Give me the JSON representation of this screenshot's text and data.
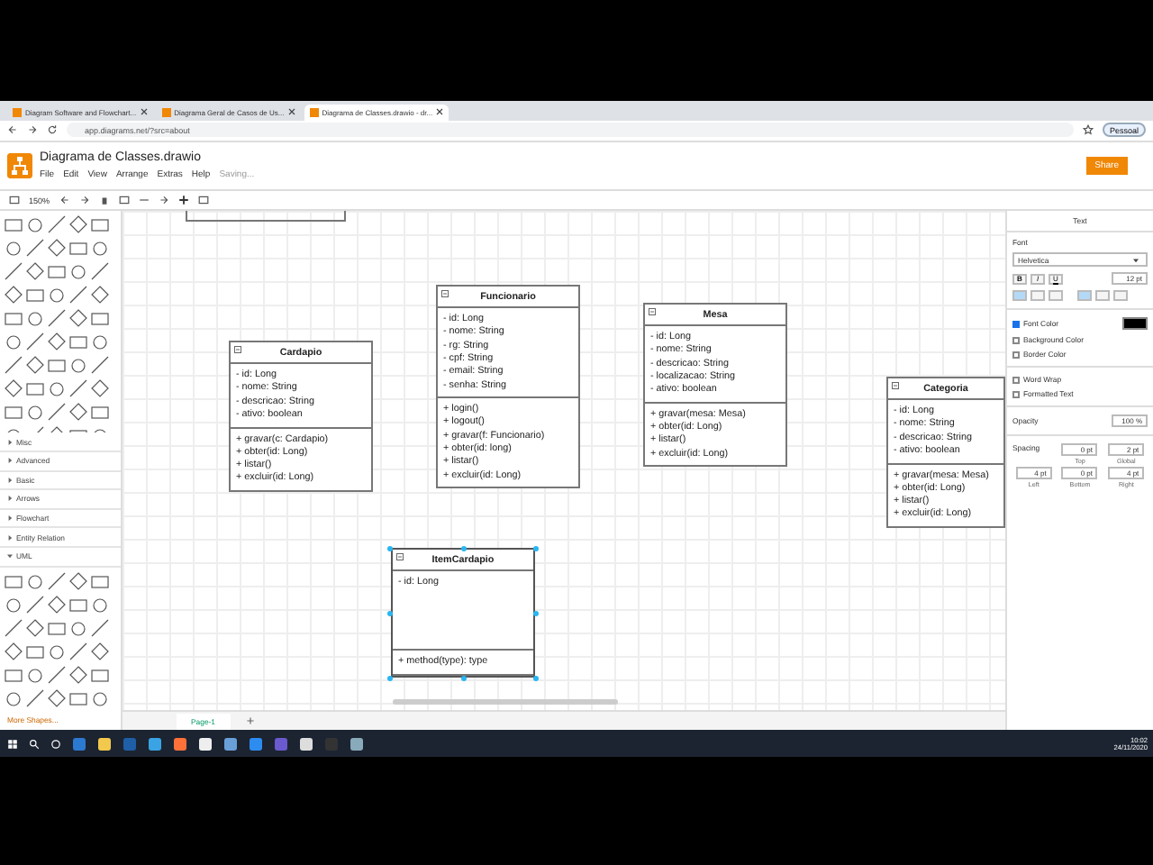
{
  "browser": {
    "tabs": [
      {
        "title": "Diagram Software and Flowchart...",
        "selected": false
      },
      {
        "title": "Diagrama Geral de Casos de Us...",
        "selected": false
      },
      {
        "title": "Diagrama de Classes.drawio - dr...",
        "selected": true
      }
    ],
    "address": "app.diagrams.net/?src=about",
    "profile": "Pessoal"
  },
  "app": {
    "title": "Diagrama de Classes.drawio",
    "menus": [
      "File",
      "Edit",
      "View",
      "Arrange",
      "Extras",
      "Help"
    ],
    "status": "Saving...",
    "share": "Share"
  },
  "toolbar": {
    "zoom": "150%"
  },
  "sidebar": {
    "sections": [
      {
        "label": "Misc",
        "expanded": false
      },
      {
        "label": "Advanced",
        "expanded": false
      },
      {
        "label": "Basic",
        "expanded": false
      },
      {
        "label": "Arrows",
        "expanded": false
      },
      {
        "label": "Flowchart",
        "expanded": false
      },
      {
        "label": "Entity Relation",
        "expanded": false
      },
      {
        "label": "UML",
        "expanded": true
      }
    ],
    "more_shapes": "More Shapes..."
  },
  "canvas": {
    "classes": [
      {
        "name": "Cardapio",
        "attributes": [
          "- id: Long",
          "- nome: String",
          "- descricao: String",
          "- ativo: boolean"
        ],
        "methods": [
          "+ gravar(c: Cardapio)",
          "+ obter(id: Long)",
          "+ listar()",
          "+ excluir(id: Long)"
        ],
        "selected": false
      },
      {
        "name": "Funcionario",
        "attributes": [
          "- id: Long",
          "- nome: String",
          "- rg: String",
          "- cpf: String",
          "- email: String",
          "- senha: String"
        ],
        "methods": [
          "+ login()",
          "+ logout()",
          "+ gravar(f: Funcionario)",
          "+ obter(id: long)",
          "+ listar()",
          "+ excluir(id: Long)"
        ],
        "selected": false
      },
      {
        "name": "Mesa",
        "attributes": [
          "- id: Long",
          "- nome: String",
          "- descricao: String",
          "- localizacao: String",
          "- ativo: boolean"
        ],
        "methods": [
          "+ gravar(mesa: Mesa)",
          "+ obter(id: Long)",
          "+ listar()",
          "+ excluir(id: Long)"
        ],
        "selected": false
      },
      {
        "name": "Categoria",
        "attributes": [
          "- id: Long",
          "- nome: String",
          "- descricao: String",
          "- ativo: boolean"
        ],
        "methods": [
          "+ gravar(mesa: Mesa)",
          "+ obter(id: Long)",
          "+ listar()",
          "+ excluir(id: Long)"
        ],
        "selected": false
      },
      {
        "name": "ItemCardapio",
        "attributes": [
          "- id: Long"
        ],
        "methods": [
          "+ method(type): type"
        ],
        "selected": true
      }
    ]
  },
  "format_panel": {
    "tab": "Text",
    "font_label": "Font",
    "font": "Helvetica",
    "style_buttons": [
      "B",
      "I",
      "U"
    ],
    "font_size": "12 pt",
    "h_align": [
      {
        "selected": true
      },
      {
        "selected": false
      },
      {
        "selected": false
      }
    ],
    "v_align": [
      {
        "selected": true
      },
      {
        "selected": false
      },
      {
        "selected": false
      }
    ],
    "checkboxes": [
      {
        "label": "Font Color",
        "checked": true
      },
      {
        "label": "Background Color",
        "checked": false
      },
      {
        "label": "Border Color",
        "checked": false
      },
      {
        "label": "Word Wrap",
        "checked": false
      },
      {
        "label": "Formatted Text",
        "checked": false
      }
    ],
    "opacity_label": "Opacity",
    "opacity": "100 %",
    "spacing_label": "Spacing",
    "spacing": [
      {
        "label": "Top",
        "value": "0 pt"
      },
      {
        "label": "Global",
        "value": "2 pt"
      },
      {
        "label": "Left",
        "value": "4 pt"
      },
      {
        "label": "Bottom",
        "value": "0 pt"
      },
      {
        "label": "Right",
        "value": "4 pt"
      }
    ]
  },
  "pages": [
    {
      "label": "Page-1",
      "selected": true
    }
  ],
  "taskbar": {
    "time": "10:02",
    "date": "24/11/2020"
  }
}
